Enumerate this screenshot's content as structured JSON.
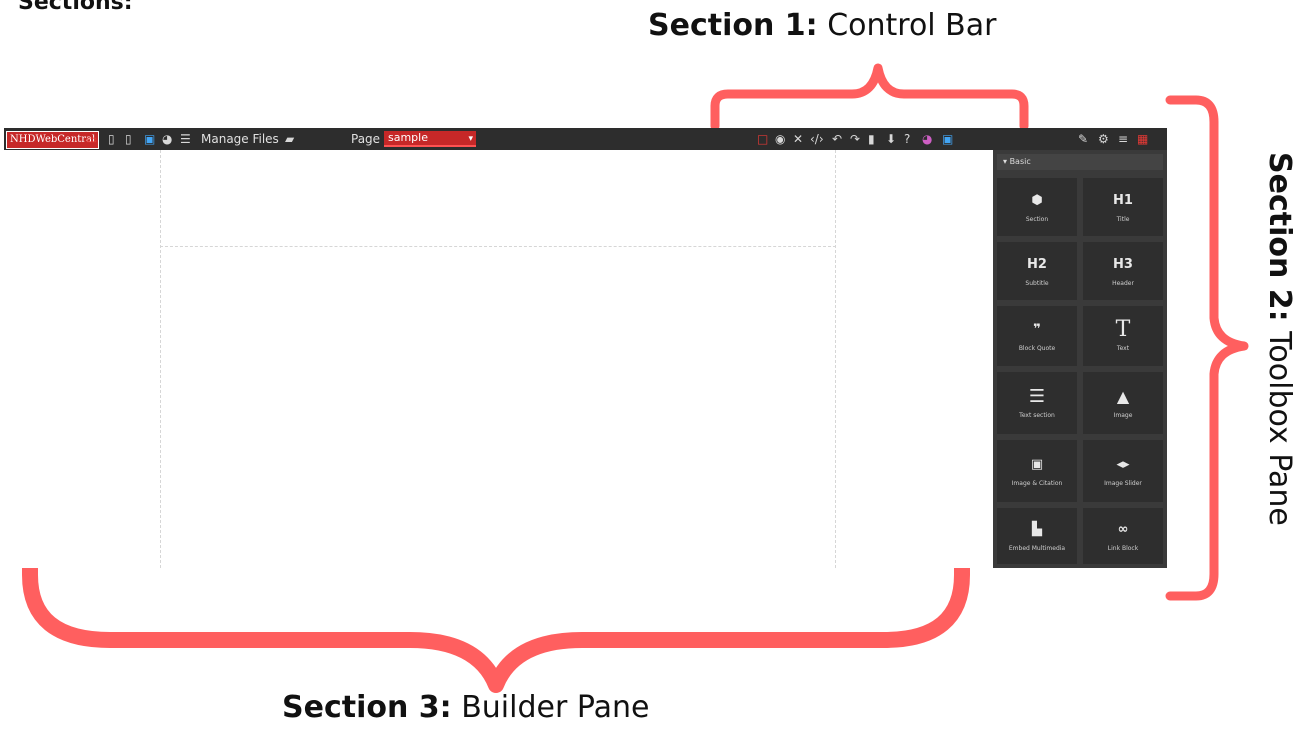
{
  "labels": {
    "heading": "Sections:",
    "section1_bold": "Section 1:",
    "section1_text": "Control Bar",
    "section2_bold": "Section 2:",
    "section2_text": "Toolbox Pane",
    "section3_bold": "Section 3:",
    "section3_text": "Builder Pane",
    "annotation_color": "#ff5f5f"
  },
  "controlbar": {
    "logo": "NHDWebCentral",
    "manage_files": "Manage Files",
    "page_label": "Page",
    "page_value": "sample",
    "left_icons": [
      "desktop-icon",
      "tablet-icon",
      "mobile-icon",
      "code-icon",
      "palette-icon",
      "layout-icon",
      "folder-icon"
    ],
    "right_icons": [
      "square-outline-icon",
      "eye-icon",
      "fullscreen-icon",
      "code-icon",
      "undo-icon",
      "redo-icon",
      "trash-icon",
      "download-icon",
      "help-icon",
      "palette-icon",
      "code-icon"
    ],
    "panel_icons": [
      "brush-icon",
      "gear-icon",
      "menu-icon",
      "blocks-icon"
    ]
  },
  "toolbox": {
    "category": "Basic",
    "blocks": [
      {
        "icon": "⬢",
        "label": "Section"
      },
      {
        "icon": "H1",
        "label": "Title"
      },
      {
        "icon": "H2",
        "label": "Subtitle"
      },
      {
        "icon": "H3",
        "label": "Header"
      },
      {
        "icon": "❞",
        "label": "Block Quote"
      },
      {
        "icon": "T",
        "label": "Text"
      },
      {
        "icon": "☰",
        "label": "Text section"
      },
      {
        "icon": "▲",
        "label": "Image"
      },
      {
        "icon": "▣",
        "label": "Image & Citation"
      },
      {
        "icon": "◂▸",
        "label": "Image Slider"
      },
      {
        "icon": "▙",
        "label": "Embed Multimedia"
      },
      {
        "icon": "∞",
        "label": "Link Block"
      }
    ]
  }
}
